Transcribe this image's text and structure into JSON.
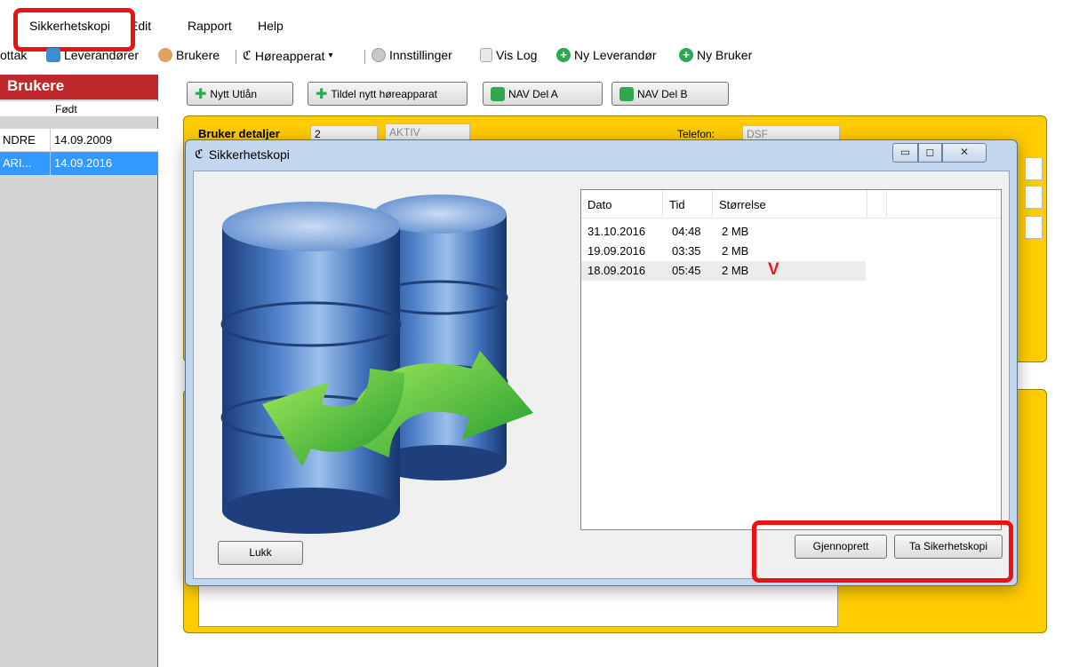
{
  "menu": {
    "items": [
      "Sikkerhetskopi",
      "Edit",
      "Rapport",
      "Help"
    ]
  },
  "toolbar": {
    "items": [
      "ottak",
      "Leverandører",
      "Brukere",
      "Høreapperat",
      "Innstillinger",
      "Vis Log",
      "Ny Leverandør",
      "Ny Bruker"
    ]
  },
  "left_panel": {
    "title": "Brukere",
    "column_header": "Født",
    "rows": [
      {
        "name": "NDRE",
        "born": "14.09.2009",
        "selected": false
      },
      {
        "name": "ARI...",
        "born": "14.09.2016",
        "selected": true
      }
    ]
  },
  "form": {
    "buttons": [
      "Nytt Utlån",
      "Tildel nytt høreapparat",
      "NAV Del A",
      "NAV Del B"
    ],
    "details_label": "Bruker detaljer",
    "id_value": "2",
    "status_value": "AKTIV",
    "phone_label": "Telefon:",
    "phone_value": "DSF"
  },
  "dialog": {
    "title": "Sikkerhetskopi",
    "window_buttons": [
      "minimize",
      "maximize",
      "close"
    ],
    "list": {
      "columns": [
        "Dato",
        "Tid",
        "Størrelse"
      ],
      "rows": [
        {
          "dato": "31.10.2016",
          "tid": "04:48",
          "storrelse": "2 MB",
          "selected": false
        },
        {
          "dato": "19.09.2016",
          "tid": "03:35",
          "storrelse": "2 MB",
          "selected": false
        },
        {
          "dato": "18.09.2016",
          "tid": "05:45",
          "storrelse": "2 MB",
          "selected": true
        }
      ],
      "check_mark": "V"
    },
    "buttons": {
      "close": "Lukk",
      "restore": "Gjennoprett",
      "backup": "Ta Sikerhetskopi"
    }
  },
  "colors": {
    "highlight": "#ee1111",
    "left_title_bg": "#c0292b",
    "selected_row": "#3399ff",
    "panel_yellow": "#ffcc00"
  }
}
